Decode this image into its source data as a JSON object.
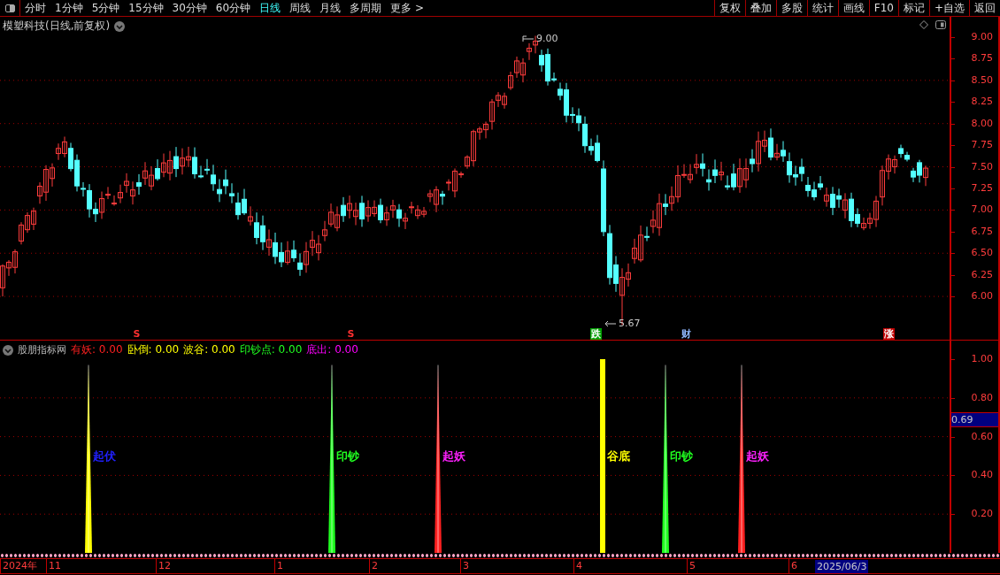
{
  "toolbar": {
    "periods": [
      {
        "label": "分时",
        "selected": false
      },
      {
        "label": "1分钟",
        "selected": false
      },
      {
        "label": "5分钟",
        "selected": false
      },
      {
        "label": "15分钟",
        "selected": false
      },
      {
        "label": "30分钟",
        "selected": false
      },
      {
        "label": "60分钟",
        "selected": false
      },
      {
        "label": "日线",
        "selected": true
      },
      {
        "label": "周线",
        "selected": false
      },
      {
        "label": "月线",
        "selected": false
      },
      {
        "label": "多周期",
        "selected": false
      },
      {
        "label": "更多 >",
        "selected": false
      }
    ],
    "tools": [
      "复权",
      "叠加",
      "多股",
      "统计",
      "画线",
      "F10",
      "标记",
      "+自选",
      "返回"
    ]
  },
  "chart": {
    "title": "模塑科技(日线,前复权)",
    "high_label": "9.00",
    "low_label": "5.67",
    "price_ticks": [
      "9.00",
      "8.75",
      "8.50",
      "8.25",
      "8.00",
      "7.75",
      "7.50",
      "7.25",
      "7.00",
      "6.75",
      "6.50",
      "6.25",
      "6.00"
    ],
    "signals": [
      {
        "label": "S",
        "kind": "text",
        "color": "#ff3030"
      },
      {
        "label": "S",
        "kind": "text",
        "color": "#ff3030"
      },
      {
        "label": "跌",
        "kind": "tag",
        "color": "#00a000"
      },
      {
        "label": "财",
        "kind": "text",
        "color": "#8fb8ff"
      },
      {
        "label": "涨",
        "kind": "tag",
        "color": "#c00000"
      }
    ]
  },
  "indicator": {
    "name": "股朋指标网",
    "legend": [
      {
        "label": "有妖:",
        "value": "0.00",
        "color": "#ff2020"
      },
      {
        "label": "卧倒:",
        "value": "0.00",
        "color": "#ffff00"
      },
      {
        "label": "波谷:",
        "value": "0.00",
        "color": "#ffff00"
      },
      {
        "label": "印钞点:",
        "value": "0.00",
        "color": "#20ff20"
      },
      {
        "label": "底出:",
        "value": "0.00",
        "color": "#ff00ff"
      }
    ],
    "spikes": [
      {
        "kind": "spike",
        "color": "#ffff00"
      },
      {
        "kind": "spike",
        "color": "#20ff20"
      },
      {
        "kind": "spike",
        "color": "#ff2020"
      },
      {
        "kind": "bar",
        "color": "#ffff00"
      },
      {
        "kind": "spike",
        "color": "#20ff20"
      },
      {
        "kind": "spike",
        "color": "#ff2020"
      }
    ],
    "spike_labels": [
      {
        "label": "起伏",
        "color": "#2020ff"
      },
      {
        "label": "印钞",
        "color": "#20ff20"
      },
      {
        "label": "起妖",
        "color": "#ff20ff"
      },
      {
        "label": "谷底",
        "color": "#ffff00"
      },
      {
        "label": "印钞",
        "color": "#20ff20"
      },
      {
        "label": "起妖",
        "color": "#ff20ff"
      }
    ],
    "ticks": [
      "1.00",
      "0.80",
      "0.60",
      "0.40",
      "0.20"
    ],
    "current": "0.69"
  },
  "time_axis": {
    "labels": [
      "2024年",
      "11",
      "12",
      "1",
      "2",
      "3",
      "4",
      "5",
      "6"
    ],
    "current": "2025/06/3"
  }
}
